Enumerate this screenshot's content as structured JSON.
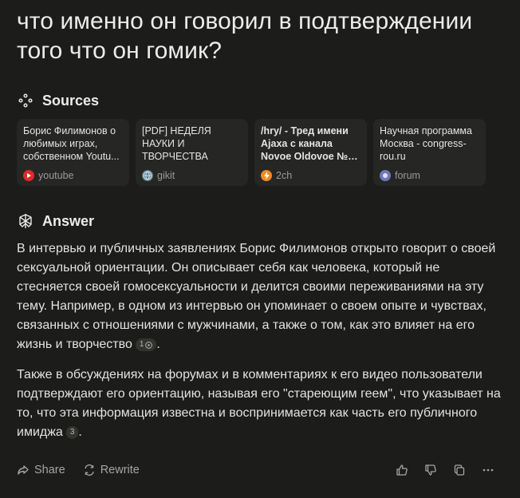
{
  "question": "что именно он говорил в подтверждении того что он гомик?",
  "sources": {
    "heading": "Sources",
    "items": [
      {
        "title": "Борис Филимонов о любимых играх, собственном Youtu...",
        "site": "youtube",
        "icon": "youtube-icon",
        "color": "#e02a2a",
        "bold": false
      },
      {
        "title": "[PDF] НЕДЕЛЯ НАУКИ И ТВОРЧЕСТВА",
        "site": "gikit",
        "icon": "globe-icon",
        "color": "#8ab4c8",
        "bold": false
      },
      {
        "title": "/hry/ - Тред имени Ajaxa с канала Novoe Oldovoe № 50 -...",
        "site": "2ch",
        "icon": "2ch-icon",
        "color": "#f08a24",
        "bold": true
      },
      {
        "title": "Научная программа Москва - congress-rou.ru",
        "site": "forum",
        "icon": "forum-icon",
        "color": "#8a95d8",
        "bold": false
      }
    ]
  },
  "answer": {
    "heading": "Answer",
    "paragraph1": "В интервью и публичных заявлениях Борис Филимонов открыто говорит о своей сексуальной ориентации. Он описывает себя как человека, который не стесняется своей гомосексуальности и делится своими переживаниями на эту тему. Например, в одном из интервью он упоминает о своем опыте и чувствах, связанных с отношениями с мужчинами, а также о том, как это влияет на его жизнь и творчество",
    "citation1": "1",
    "paragraph2": "Также в обсуждениях на форумах и в комментариях к его видео пользователи подтверждают его ориентацию, называя его \"стареющим геем\", что указывает на то, что эта информация известна и воспринимается как часть его публичного имиджа",
    "citation2": "3",
    "period": "."
  },
  "footer": {
    "share_label": "Share",
    "rewrite_label": "Rewrite"
  }
}
